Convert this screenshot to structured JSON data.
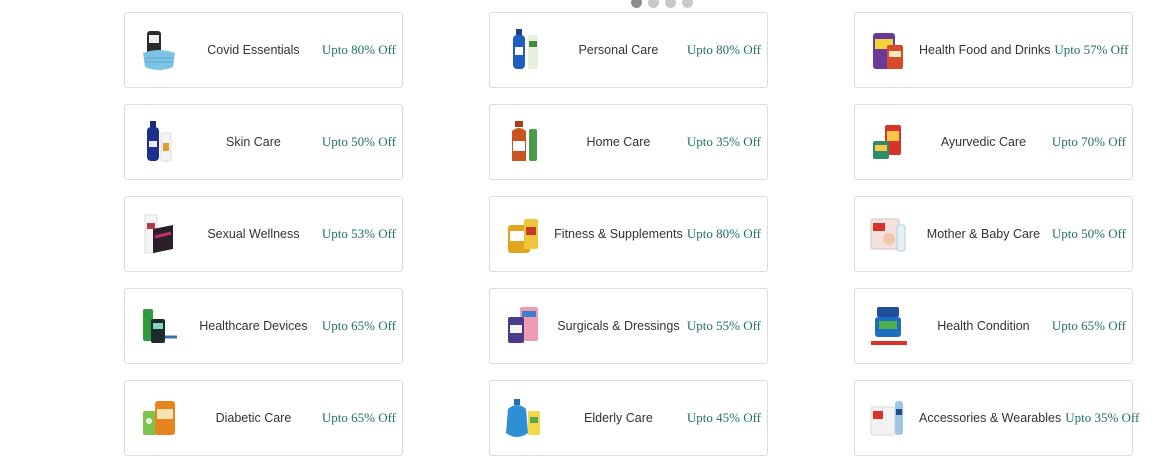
{
  "carousel": {
    "dots": 4,
    "active": 0
  },
  "categories": [
    {
      "name": "Covid Essentials",
      "offer": "Upto 80% Off",
      "icon": "mask-sanitizer-icon"
    },
    {
      "name": "Personal Care",
      "offer": "Upto 80% Off",
      "icon": "lotion-bottles-icon"
    },
    {
      "name": "Health Food and Drinks",
      "offer": "Upto 57% Off",
      "icon": "health-drink-jar-icon"
    },
    {
      "name": "Skin Care",
      "offer": "Upto 50% Off",
      "icon": "skin-lotion-icon"
    },
    {
      "name": "Home Care",
      "offer": "Upto 35% Off",
      "icon": "disinfectant-bottle-icon"
    },
    {
      "name": "Ayurvedic Care",
      "offer": "Upto 70% Off",
      "icon": "ayurvedic-jars-icon"
    },
    {
      "name": "Sexual Wellness",
      "offer": "Upto 53% Off",
      "icon": "wellness-box-icon"
    },
    {
      "name": "Fitness & Supplements",
      "offer": "Upto 80% Off",
      "icon": "supplement-tub-icon"
    },
    {
      "name": "Mother & Baby Care",
      "offer": "Upto 50% Off",
      "icon": "baby-diaper-pack-icon"
    },
    {
      "name": "Healthcare Devices",
      "offer": "Upto 65% Off",
      "icon": "medical-device-icon"
    },
    {
      "name": "Surgicals & Dressings",
      "offer": "Upto 55% Off",
      "icon": "dressing-pack-icon"
    },
    {
      "name": "Health Condition",
      "offer": "Upto 65% Off",
      "icon": "vaporub-jar-icon"
    },
    {
      "name": "Diabetic Care",
      "offer": "Upto 65% Off",
      "icon": "diabetic-products-icon"
    },
    {
      "name": "Elderly Care",
      "offer": "Upto 45% Off",
      "icon": "hot-water-bag-icon"
    },
    {
      "name": "Accessories & Wearables",
      "offer": "Upto 35% Off",
      "icon": "accessories-box-icon"
    }
  ]
}
